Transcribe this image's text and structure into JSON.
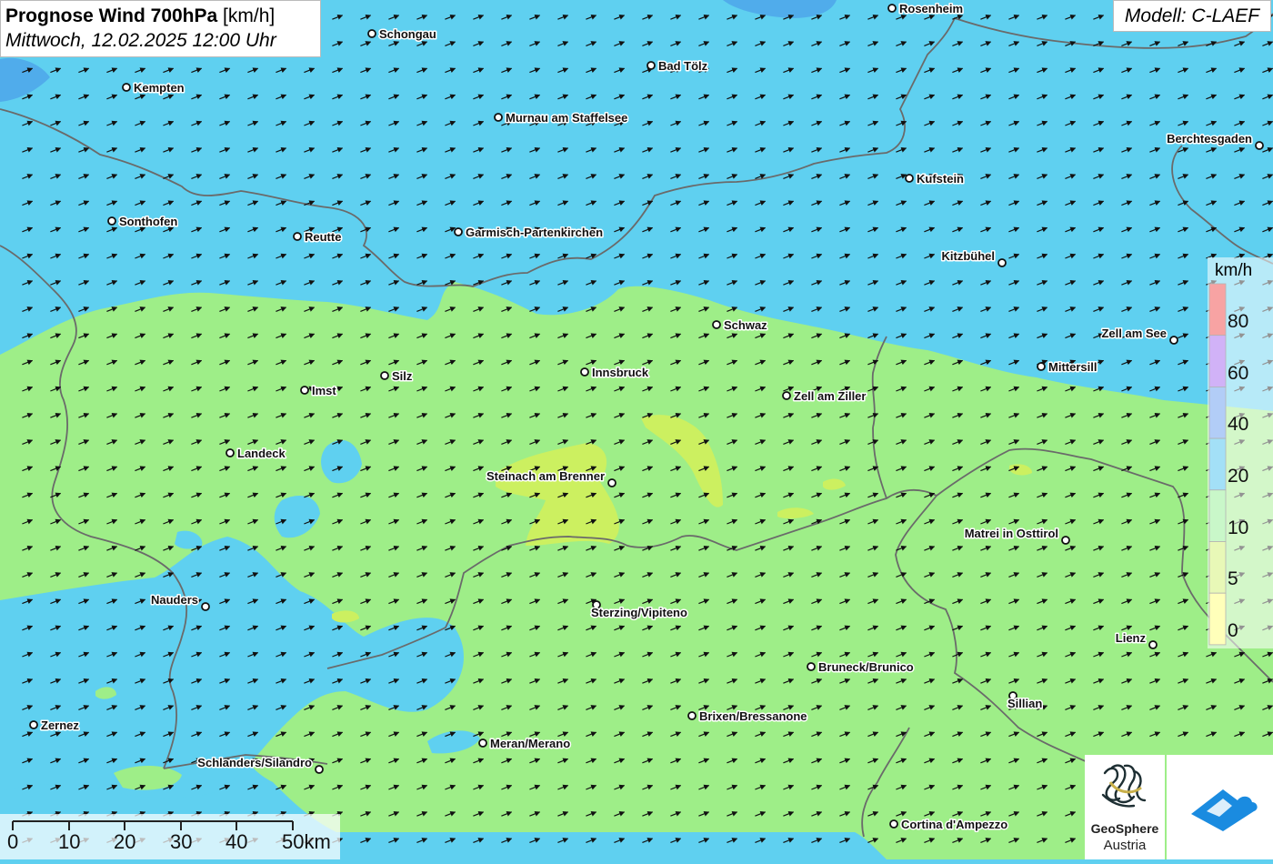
{
  "title": {
    "main": "Prognose Wind 700hPa",
    "unit": "[km/h]",
    "datetime": "Mittwoch, 12.02.2025 12:00 Uhr"
  },
  "model": "Modell: C-LAEF",
  "legend": {
    "unit": "km/h",
    "ticks": [
      "0",
      "5",
      "10",
      "20",
      "40",
      "60",
      "80"
    ],
    "colors": [
      "#ffff66",
      "#ccf060",
      "#88ee88",
      "#33bbee",
      "#5590ee",
      "#9955ee",
      "#ee3333"
    ]
  },
  "scale_bar": {
    "labels": [
      "0",
      "10",
      "20",
      "30",
      "40",
      "50km"
    ]
  },
  "logos": {
    "geosphere_line1": "GeoSphere",
    "geosphere_line2": "Austria"
  },
  "colors": {
    "zone_10_20_green": "#9eee88",
    "zone_20_40_blue": "#5fd0f0",
    "zone_5_10_yellow": "#ccf060",
    "border": "#6a6a6a"
  },
  "wind": {
    "direction": "from west-southwest",
    "speed_range_kmh": "10-40"
  },
  "cities": [
    {
      "name": "Rosenheim"
    },
    {
      "name": "Schongau"
    },
    {
      "name": "Bad Tölz"
    },
    {
      "name": "Kempten"
    },
    {
      "name": "Murnau am Staffelsee"
    },
    {
      "name": "Berchtesgaden"
    },
    {
      "name": "Kufstein"
    },
    {
      "name": "Sonthofen"
    },
    {
      "name": "Reutte"
    },
    {
      "name": "Garmisch-Partenkirchen"
    },
    {
      "name": "Kitzbühel"
    },
    {
      "name": "Schwaz"
    },
    {
      "name": "Zell am See"
    },
    {
      "name": "Innsbruck"
    },
    {
      "name": "Silz"
    },
    {
      "name": "Mittersill"
    },
    {
      "name": "Imst"
    },
    {
      "name": "Zell am Ziller"
    },
    {
      "name": "Landeck"
    },
    {
      "name": "Steinach am Brenner"
    },
    {
      "name": "Matrei in Osttirol"
    },
    {
      "name": "Nauders"
    },
    {
      "name": "Sterzing/Vipiteno"
    },
    {
      "name": "Lienz"
    },
    {
      "name": "Bruneck/Brunico"
    },
    {
      "name": "Sillian"
    },
    {
      "name": "Brixen/Bressanone"
    },
    {
      "name": "Zernez"
    },
    {
      "name": "Meran/Merano"
    },
    {
      "name": "Schlanders/Silandro"
    },
    {
      "name": "Cortina d'Ampezzo"
    }
  ]
}
